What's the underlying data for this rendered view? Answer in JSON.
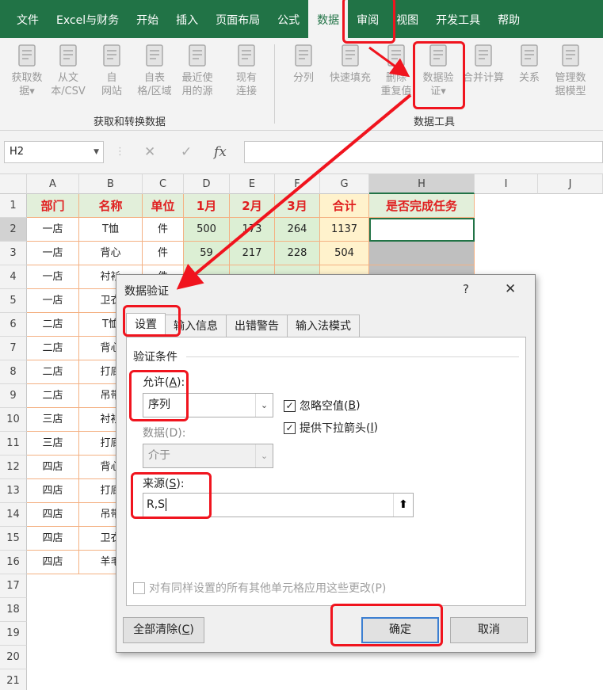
{
  "ribbon_tabs": [
    "文件",
    "Excel与财务",
    "开始",
    "插入",
    "页面布局",
    "公式",
    "数据",
    "审阅",
    "视图",
    "开发工具",
    "帮助"
  ],
  "ribbon": {
    "get_transform": {
      "buttons": [
        "获取数\n据▾",
        "从文\n本/CSV",
        "自\n网站",
        "自表\n格/区域",
        "最近使\n用的源",
        "现有\n连接"
      ],
      "label": "获取和转换数据"
    },
    "data_tools": {
      "buttons": [
        "分列",
        "快速填充",
        "删除\n重复值",
        "数据验\n证▾",
        "合并计算",
        "关系",
        "管理数\n据模型"
      ],
      "label": "数据工具"
    }
  },
  "formula_bar": {
    "name_box": "H2",
    "cancel": "✕",
    "enter": "✓",
    "fx": "fx",
    "value": ""
  },
  "grid": {
    "columns": [
      "A",
      "B",
      "C",
      "D",
      "E",
      "F",
      "G",
      "H",
      "I",
      "J"
    ],
    "header_row": [
      "部门",
      "名称",
      "单位",
      "1月",
      "2月",
      "3月",
      "合计",
      "是否完成任务"
    ],
    "rows": [
      [
        "一店",
        "T恤",
        "件",
        "500",
        "173",
        "264",
        "1137",
        ""
      ],
      [
        "一店",
        "背心",
        "件",
        "59",
        "217",
        "228",
        "504",
        ""
      ],
      [
        "一店",
        "衬衫",
        "件",
        "",
        "",
        "",
        "",
        ""
      ],
      [
        "一店",
        "卫衣",
        "",
        "",
        "",
        "",
        "",
        ""
      ],
      [
        "二店",
        "T恤",
        "",
        "",
        "",
        "",
        "",
        ""
      ],
      [
        "二店",
        "背心",
        "",
        "",
        "",
        "",
        "",
        ""
      ],
      [
        "二店",
        "打底",
        "",
        "",
        "",
        "",
        "",
        ""
      ],
      [
        "二店",
        "吊带",
        "",
        "",
        "",
        "",
        "",
        ""
      ],
      [
        "三店",
        "衬衫",
        "",
        "",
        "",
        "",
        "",
        ""
      ],
      [
        "三店",
        "打底",
        "",
        "",
        "",
        "",
        "",
        ""
      ],
      [
        "四店",
        "背心",
        "",
        "",
        "",
        "",
        "",
        ""
      ],
      [
        "四店",
        "打底",
        "",
        "",
        "",
        "",
        "",
        ""
      ],
      [
        "四店",
        "吊带",
        "",
        "",
        "",
        "",
        "",
        ""
      ],
      [
        "四店",
        "卫衣",
        "",
        "",
        "",
        "",
        "",
        ""
      ],
      [
        "四店",
        "羊毛",
        "",
        "",
        "",
        "",
        "",
        ""
      ]
    ],
    "row_numbers": [
      "1",
      "2",
      "3",
      "4",
      "5",
      "6",
      "7",
      "8",
      "9",
      "10",
      "11",
      "12",
      "13",
      "14",
      "15",
      "16",
      "17",
      "18",
      "19",
      "20",
      "21"
    ]
  },
  "dialog": {
    "title": "数据验证",
    "help": "?",
    "close": "✕",
    "tabs": [
      "设置",
      "输入信息",
      "出错警告",
      "输入法模式"
    ],
    "section": "验证条件",
    "allow_label_pre": "允许(",
    "allow_key": "A",
    "allow_label_post": "):",
    "allow_value": "序列",
    "data_label": "数据(D):",
    "data_value": "介于",
    "ignore_blank_pre": "忽略空值(",
    "ignore_blank_key": "B",
    "ignore_blank_post": ")",
    "ignore_blank_checked": true,
    "dropdown_pre": "提供下拉箭头(",
    "dropdown_key": "I",
    "dropdown_post": ")",
    "dropdown_checked": true,
    "source_label_pre": "来源(",
    "source_key": "S",
    "source_label_post": "):",
    "source_value": "R,S",
    "apply_all": "对有同样设置的所有其他单元格应用这些更改(P)",
    "clear_all_pre": "全部清除(",
    "clear_all_key": "C",
    "clear_all_post": ")",
    "ok": "确定",
    "cancel": "取消"
  },
  "colors": {
    "ribbon_green": "#217346",
    "header_fill": "#e2efda",
    "month_fill": "#dcefd4",
    "total_fill": "#fff2cc",
    "header_text": "#e02020",
    "selection_gray": "#bfbfbf",
    "annotation_red": "#f0141e",
    "border_orange": "#f4b183"
  }
}
